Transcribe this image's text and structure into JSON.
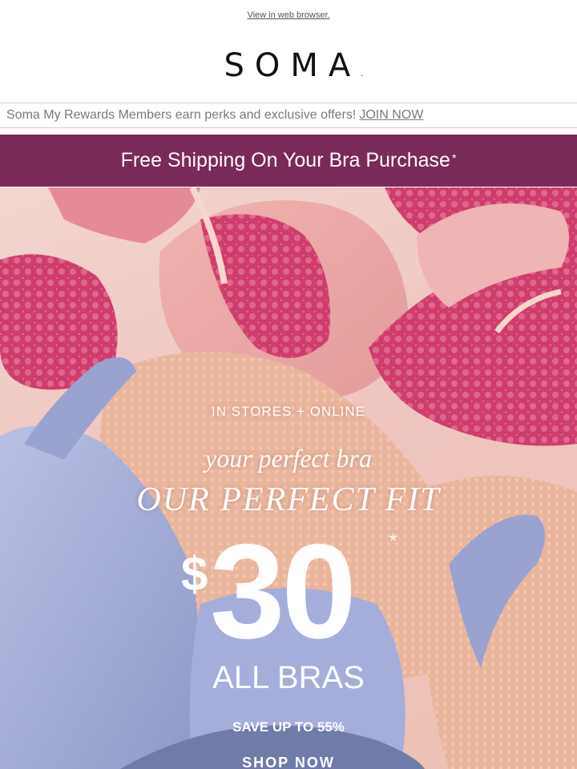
{
  "header": {
    "web_link": "View in web browser.",
    "logo": "SOMA",
    "logo_dot": "."
  },
  "rewards": {
    "text": "Soma My Rewards Members earn perks and exclusive offers!",
    "join_link": "JOIN NOW"
  },
  "shipping": {
    "text": "Free Shipping On Your Bra Purchase",
    "asterisk": "*"
  },
  "hero": {
    "eyebrow": "IN STORES + ONLINE",
    "script_line": "your perfect bra",
    "headline": "OUR PERFECT FIT",
    "price_symbol": "$",
    "price_value": "30",
    "price_asterisk": "*",
    "subhead": "ALL BRAS",
    "savings": "SAVE UP TO 55%",
    "cta": "SHOP NOW"
  },
  "colors": {
    "banner_bg": "#7a2a58",
    "hero_pink": "#d4406f",
    "hero_lavender": "#a9b2d8",
    "hero_peach": "#e9b49a"
  }
}
